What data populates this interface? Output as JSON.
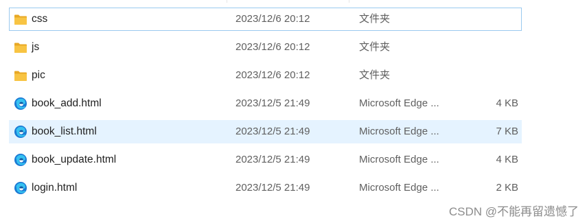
{
  "files": [
    {
      "name": "css",
      "date": "2023/12/6 20:12",
      "type": "文件夹",
      "size": "",
      "icon": "folder-icon",
      "state": "focused"
    },
    {
      "name": "js",
      "date": "2023/12/6 20:12",
      "type": "文件夹",
      "size": "",
      "icon": "folder-icon",
      "state": ""
    },
    {
      "name": "pic",
      "date": "2023/12/6 20:12",
      "type": "文件夹",
      "size": "",
      "icon": "folder-icon",
      "state": ""
    },
    {
      "name": "book_add.html",
      "date": "2023/12/5 21:49",
      "type": "Microsoft Edge ...",
      "size": "4 KB",
      "icon": "edge-html-icon",
      "state": ""
    },
    {
      "name": "book_list.html",
      "date": "2023/12/5 21:49",
      "type": "Microsoft Edge ...",
      "size": "7 KB",
      "icon": "edge-html-icon",
      "state": "selected"
    },
    {
      "name": "book_update.html",
      "date": "2023/12/5 21:49",
      "type": "Microsoft Edge ...",
      "size": "4 KB",
      "icon": "edge-html-icon",
      "state": ""
    },
    {
      "name": "login.html",
      "date": "2023/12/5 21:49",
      "type": "Microsoft Edge ...",
      "size": "2 KB",
      "icon": "edge-html-icon",
      "state": ""
    }
  ],
  "watermark": "CSDN @不能再留遗憾了",
  "colors": {
    "selected_bg": "#e5f3ff",
    "focus_border": "#99c9ef",
    "folder": "#f8c443",
    "edge": "#1b7ad4"
  }
}
